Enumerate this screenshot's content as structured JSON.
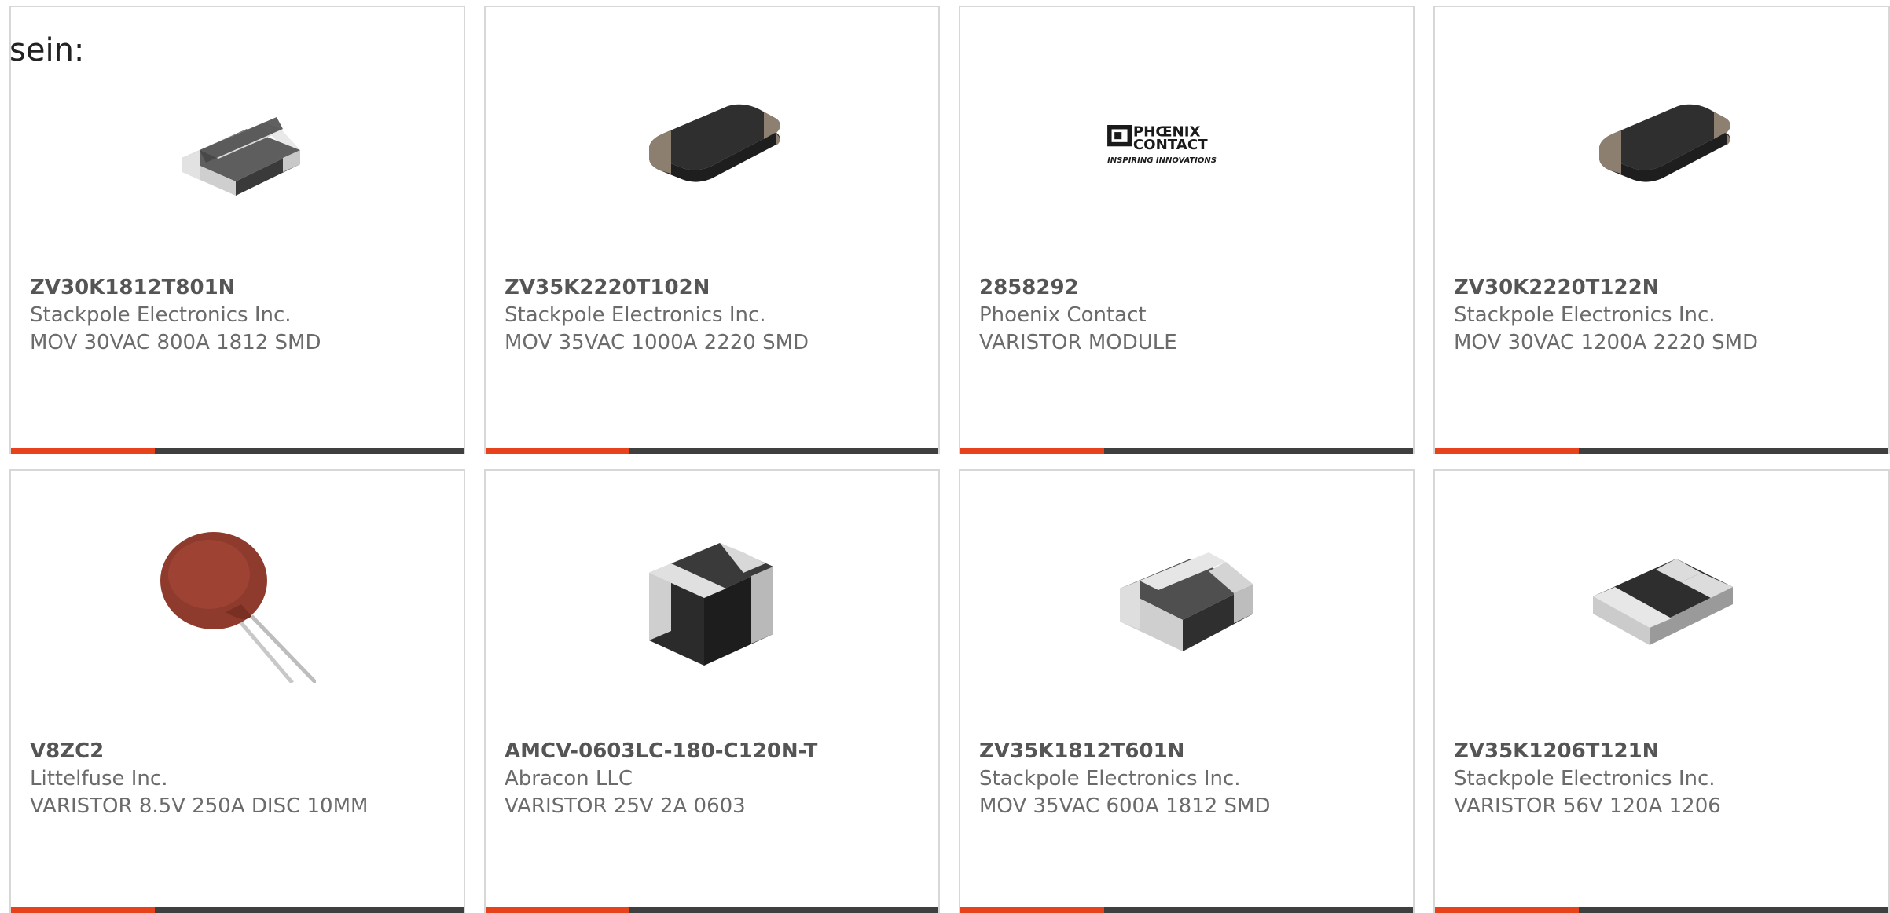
{
  "intro_text": "sein:",
  "colors": {
    "accent": "#e8421c",
    "bar_dark": "#3f3f3f",
    "border": "#d7d7d7",
    "text": "#6b6b6b",
    "part_number": "#555555"
  },
  "products": [
    {
      "part_number": "ZV30K1812T801N",
      "manufacturer": "Stackpole Electronics Inc.",
      "description": "MOV 30VAC 800A 1812 SMD",
      "image": "smd-chip-white-ends"
    },
    {
      "part_number": "ZV35K2220T102N",
      "manufacturer": "Stackpole Electronics Inc.",
      "description": "MOV 35VAC 1000A 2220 SMD",
      "image": "smd-chip-rounded"
    },
    {
      "part_number": "2858292",
      "manufacturer": "Phoenix Contact",
      "description": "VARISTOR MODULE",
      "image": "phoenix-contact-logo",
      "logo_text": {
        "line1": "PHŒNIX",
        "line2": "CONTACT",
        "tagline": "INSPIRING INNOVATIONS"
      }
    },
    {
      "part_number": "ZV30K2220T122N",
      "manufacturer": "Stackpole Electronics Inc.",
      "description": "MOV 30VAC 1200A 2220 SMD",
      "image": "smd-chip-rounded"
    },
    {
      "part_number": "V8ZC2",
      "manufacturer": "Littelfuse Inc.",
      "description": "VARISTOR 8.5V 250A DISC 10MM",
      "image": "radial-disc-varistor"
    },
    {
      "part_number": "AMCV-0603LC-180-C120N-T",
      "manufacturer": "Abracon LLC",
      "description": "VARISTOR 25V 2A 0603",
      "image": "smd-chip-tall"
    },
    {
      "part_number": "ZV35K1812T601N",
      "manufacturer": "Stackpole Electronics Inc.",
      "description": "MOV 35VAC 600A 1812 SMD",
      "image": "smd-chip-white-ends"
    },
    {
      "part_number": "ZV35K1206T121N",
      "manufacturer": "Stackpole Electronics Inc.",
      "description": "VARISTOR 56V 120A 1206",
      "image": "smd-chip-flat"
    }
  ]
}
